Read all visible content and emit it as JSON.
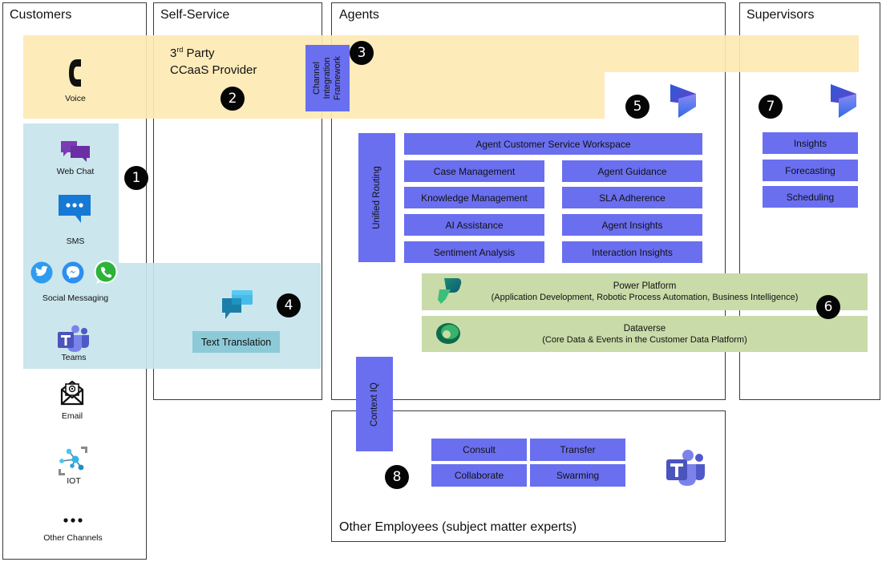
{
  "lanes": {
    "customers": "Customers",
    "self_service": "Self-Service",
    "agents": "Agents",
    "supervisors": "Supervisors",
    "other_employees": "Other Employees (subject matter experts)"
  },
  "colors": {
    "block_blue": "#6a6ff0",
    "voice_band": "#fde9b3",
    "digital_band": "#c7e4ec",
    "platform_green": "#c9dba8",
    "badge_black": "#050505"
  },
  "channels": {
    "voice": "Voice",
    "web_chat": "Web Chat",
    "sms": "SMS",
    "social_messaging": "Social Messaging",
    "teams": "Teams",
    "email": "Email",
    "iot": "IOT",
    "other": "Other Channels"
  },
  "ccaas": {
    "line1_prefix": "3",
    "line1_sup": "rd",
    "line1_suffix": " Party",
    "line2": "CCaaS Provider"
  },
  "channel_integration": {
    "line1": "Channel",
    "line2": "Integration",
    "line3": "Framework"
  },
  "text_translation": "Text Translation",
  "agents": {
    "unified_routing": "Unified Routing",
    "workspace": "Agent Customer Service Workspace",
    "left_features": [
      "Case Management",
      "Knowledge Management",
      "AI Assistance",
      "Sentiment Analysis"
    ],
    "right_features": [
      "Agent Guidance",
      "SLA Adherence",
      "Agent Insights",
      "Interaction Insights"
    ]
  },
  "supervisors": {
    "features": [
      "Insights",
      "Forecasting",
      "Scheduling"
    ]
  },
  "platform": {
    "power_platform_title": "Power Platform",
    "power_platform_sub": "(Application Development, Robotic Process Automation, Business Intelligence)",
    "dataverse_title": "Dataverse",
    "dataverse_sub": "(Core Data & Events in the Customer Data Platform)"
  },
  "context_iq": "Context IQ",
  "collaboration": {
    "items": [
      "Consult",
      "Transfer",
      "Collaborate",
      "Swarming"
    ]
  },
  "badges": [
    "1",
    "2",
    "3",
    "4",
    "5",
    "6",
    "7",
    "8"
  ]
}
